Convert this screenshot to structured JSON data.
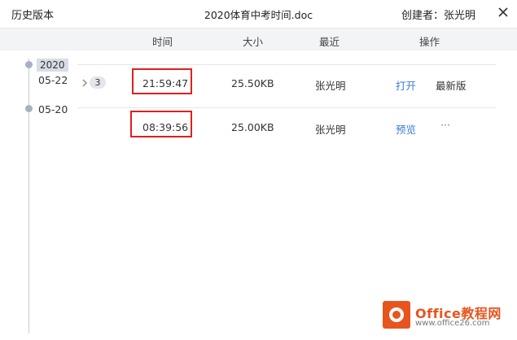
{
  "window": {
    "title": "历史版本",
    "filename": "2020体育中考时间.doc",
    "creator": "创建者：张光明"
  },
  "columns": {
    "time": "时间",
    "size": "大小",
    "recent": "最近",
    "actions": "操作"
  },
  "timeline": {
    "year": "2020"
  },
  "groups": [
    {
      "date": "05-22",
      "version_count": "3",
      "time": "21:59:47",
      "size": "25.50KB",
      "user": "张光明",
      "action": "打开",
      "tag": "最新版"
    },
    {
      "date": "05-20",
      "time": "08:39:56",
      "size": "25.00KB",
      "user": "张光明",
      "action": "预览",
      "more": "···"
    }
  ],
  "watermark": {
    "brand": "Office教程网",
    "sub": "www.office26.com"
  },
  "colors": {
    "link": "#3a7bd5",
    "highlight": "#e02020",
    "timeline_dot": "#a7b1c2",
    "brand": "#e8541e"
  }
}
